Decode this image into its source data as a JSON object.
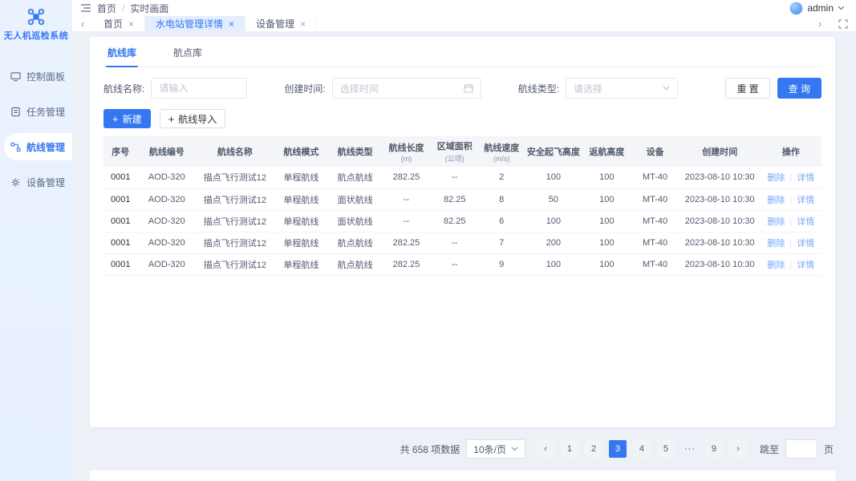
{
  "app": {
    "title": "无人机巡检系统",
    "primary_color": "#3577F0",
    "sidebar_bg": "#E9F1FD",
    "active_tab_bg": "#E4EEFF",
    "link_color": "#74A8FB"
  },
  "icons": {
    "close": "×",
    "plus": "+",
    "chevron_left": "‹",
    "chevron_right": "›",
    "ellipsis": "···",
    "breadcrumb_sep": "/",
    "action_sep": "|"
  },
  "sidebar": {
    "logo_text": "无人机巡检系统",
    "items": [
      {
        "label": "控制面板",
        "icon": "dashboard-icon",
        "active": false
      },
      {
        "label": "任务管理",
        "icon": "task-icon",
        "active": false
      },
      {
        "label": "航线管理",
        "icon": "route-icon",
        "active": true
      },
      {
        "label": "设备管理",
        "icon": "device-icon",
        "active": false
      }
    ]
  },
  "header": {
    "breadcrumb": [
      "首页",
      "实时画面"
    ],
    "user": "admin"
  },
  "tabbar": {
    "tabs": [
      {
        "label": "首页",
        "active": false
      },
      {
        "label": "水电站管理详情",
        "active": true
      },
      {
        "label": "设备管理",
        "active": false
      }
    ]
  },
  "main": {
    "tabs": [
      {
        "label": "航线库",
        "active": true
      },
      {
        "label": "航点库",
        "active": false
      }
    ],
    "filters": {
      "name_label": "航线名称:",
      "name_placeholder": "请输入",
      "time_label": "创建时间:",
      "time_placeholder": "选择时间",
      "type_label": "航线类型:",
      "type_placeholder": "请选择",
      "reset_label": "重 置",
      "search_label": "查 询"
    },
    "actions": {
      "create_label": "新建",
      "import_label": "航线导入"
    },
    "table": {
      "columns": [
        {
          "label": "序号"
        },
        {
          "label": "航线编号"
        },
        {
          "label": "航线名称"
        },
        {
          "label": "航线模式"
        },
        {
          "label": "航线类型"
        },
        {
          "label": "航线长度",
          "unit": "(m)"
        },
        {
          "label": "区域面积",
          "unit": "(公顷)"
        },
        {
          "label": "航线速度",
          "unit": "(m/s)"
        },
        {
          "label": "安全起飞高度"
        },
        {
          "label": "返航高度"
        },
        {
          "label": "设备"
        },
        {
          "label": "创建时间"
        },
        {
          "label": "操作"
        }
      ],
      "rows": [
        {
          "cells": [
            "0001",
            "AOD-320",
            "描点飞行测试12",
            "单程航线",
            "航点航线",
            "282.25",
            "--",
            "2",
            "100",
            "100",
            "MT-40",
            "2023-08-10 10:30"
          ]
        },
        {
          "cells": [
            "0001",
            "AOD-320",
            "描点飞行测试12",
            "单程航线",
            "面状航线",
            "--",
            "82.25",
            "8",
            "50",
            "100",
            "MT-40",
            "2023-08-10 10:30"
          ]
        },
        {
          "cells": [
            "0001",
            "AOD-320",
            "描点飞行测试12",
            "单程航线",
            "面状航线",
            "--",
            "82.25",
            "6",
            "100",
            "100",
            "MT-40",
            "2023-08-10 10:30"
          ]
        },
        {
          "cells": [
            "0001",
            "AOD-320",
            "描点飞行测试12",
            "单程航线",
            "航点航线",
            "282.25",
            "--",
            "7",
            "200",
            "100",
            "MT-40",
            "2023-08-10 10:30"
          ]
        },
        {
          "cells": [
            "0001",
            "AOD-320",
            "描点飞行测试12",
            "单程航线",
            "航点航线",
            "282.25",
            "--",
            "9",
            "100",
            "100",
            "MT-40",
            "2023-08-10 10:30"
          ]
        }
      ],
      "row_actions": [
        "删除",
        "详情"
      ]
    },
    "pagination": {
      "total_text": "共 658 项数据",
      "page_size": "10条/页",
      "pages": [
        "1",
        "2",
        "3",
        "4",
        "5",
        "···",
        "9"
      ],
      "current": "3",
      "jump_prefix": "跳至",
      "jump_suffix": "页"
    }
  }
}
